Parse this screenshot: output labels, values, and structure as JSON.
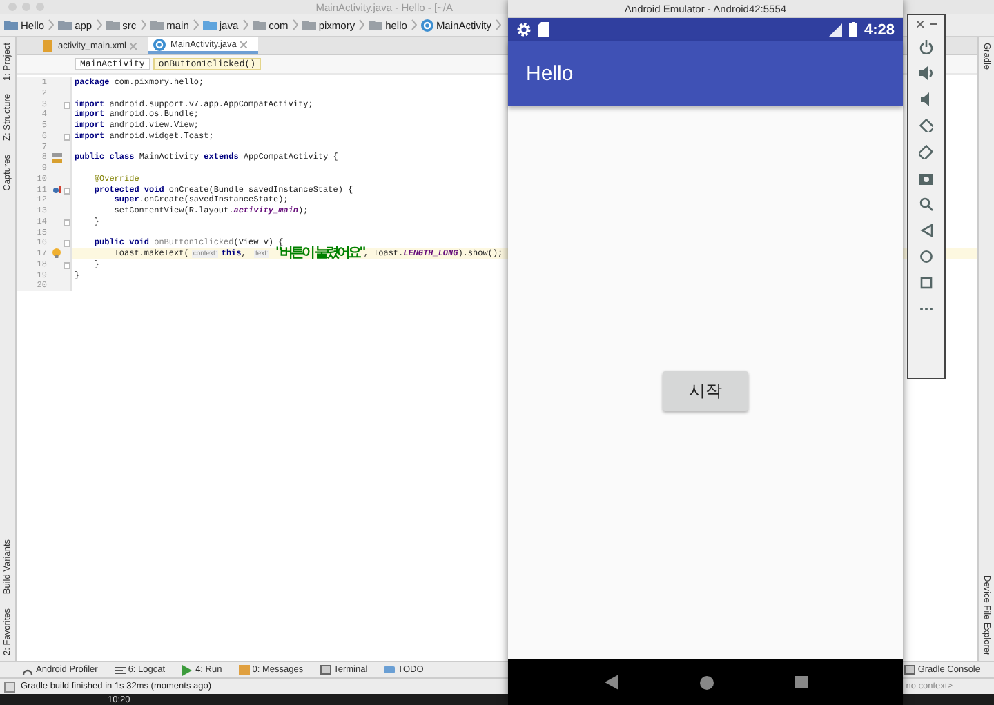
{
  "ide": {
    "title": "MainActivity.java - Hello - [~/A",
    "breadcrumbs": [
      {
        "label": "Hello",
        "kind": "project"
      },
      {
        "label": "app",
        "kind": "module"
      },
      {
        "label": "src",
        "kind": "folder"
      },
      {
        "label": "main",
        "kind": "folder"
      },
      {
        "label": "java",
        "kind": "source"
      },
      {
        "label": "com",
        "kind": "package"
      },
      {
        "label": "pixmory",
        "kind": "package"
      },
      {
        "label": "hello",
        "kind": "package"
      },
      {
        "label": "MainActivity",
        "kind": "class"
      }
    ],
    "tabs": [
      {
        "label": "activity_main.xml",
        "kind": "xml",
        "selected": false
      },
      {
        "label": "MainActivity.java",
        "kind": "class",
        "selected": true
      }
    ],
    "editor_breadcrumbs": [
      {
        "label": "MainActivity",
        "selected": false
      },
      {
        "label": "onButton1clicked()",
        "selected": true
      }
    ],
    "code_lines": [
      {
        "number": "1",
        "current": false,
        "kind": "plain",
        "fold": false,
        "segments": [
          {
            "kind": "kw",
            "text": "package"
          },
          {
            "kind": "plain",
            "text": " com.pixmory.hello;"
          }
        ]
      },
      {
        "number": "2",
        "current": false,
        "kind": "plain",
        "fold": false
      },
      {
        "number": "3",
        "current": false,
        "kind": "plain",
        "fold": true,
        "segments": [
          {
            "kind": "kw",
            "text": "import"
          },
          {
            "kind": "plain",
            "text": " android.support.v7.app.AppCompatActivity;"
          }
        ]
      },
      {
        "number": "4",
        "current": false,
        "kind": "plain",
        "fold": false,
        "segments": [
          {
            "kind": "kw",
            "text": "import"
          },
          {
            "kind": "plain",
            "text": " android.os.Bundle;"
          }
        ]
      },
      {
        "number": "5",
        "current": false,
        "kind": "plain",
        "fold": false,
        "segments": [
          {
            "kind": "kw",
            "text": "import"
          },
          {
            "kind": "plain",
            "text": " android.view.View;"
          }
        ]
      },
      {
        "number": "6",
        "current": false,
        "kind": "plain",
        "fold": true,
        "segments": [
          {
            "kind": "kw",
            "text": "import"
          },
          {
            "kind": "plain",
            "text": " android.widget.Toast;"
          }
        ]
      },
      {
        "number": "7",
        "current": false,
        "kind": "plain",
        "fold": false
      },
      {
        "number": "8",
        "current": false,
        "kind": "class",
        "fold": false,
        "segments": [
          {
            "kind": "kw",
            "text": "public class"
          },
          {
            "kind": "plain",
            "text": " MainActivity "
          },
          {
            "kind": "kw",
            "text": "extends"
          },
          {
            "kind": "plain",
            "text": " AppCompatActivity {"
          }
        ]
      },
      {
        "number": "9",
        "current": false,
        "kind": "plain",
        "fold": false
      },
      {
        "number": "10",
        "current": false,
        "kind": "plain",
        "fold": false,
        "segments": [
          {
            "kind": "ann",
            "text": "    @Override"
          }
        ]
      },
      {
        "number": "11",
        "current": false,
        "kind": "override",
        "fold": true,
        "segments": [
          {
            "kind": "kw",
            "text": "    protected void"
          },
          {
            "kind": "plain",
            "text": " onCreate(Bundle savedInstanceState) {"
          }
        ]
      },
      {
        "number": "12",
        "current": false,
        "kind": "plain",
        "fold": false,
        "segments": [
          {
            "kind": "kw",
            "text": "        super"
          },
          {
            "kind": "plain",
            "text": ".onCreate(savedInstanceState);"
          }
        ]
      },
      {
        "number": "13",
        "current": false,
        "kind": "plain",
        "fold": false,
        "segments": [
          {
            "kind": "plain",
            "text": "        setContentView(R.layout."
          },
          {
            "kind": "field",
            "text": "activity_main"
          },
          {
            "kind": "plain",
            "text": ");"
          }
        ]
      },
      {
        "number": "14",
        "current": false,
        "kind": "plain",
        "fold": true,
        "segments": [
          {
            "kind": "plain",
            "text": "    }"
          }
        ]
      },
      {
        "number": "15",
        "current": false,
        "kind": "plain",
        "fold": false
      },
      {
        "number": "16",
        "current": false,
        "kind": "plain",
        "fold": true,
        "segments": [
          {
            "kind": "kw",
            "text": "    public void "
          },
          {
            "kind": "unused",
            "text": "onButton1clicked"
          },
          {
            "kind": "plain",
            "text": "(View v) {"
          }
        ]
      },
      {
        "number": "17",
        "current": true,
        "kind": "bulb",
        "fold": false,
        "segments": [
          {
            "kind": "plain",
            "text": "        Toast.makeText("
          },
          {
            "kind": "hint",
            "text": "context:"
          },
          {
            "kind": "kw",
            "text": "this"
          },
          {
            "kind": "plain",
            "text": ", "
          },
          {
            "kind": "hint",
            "text": "text:"
          },
          {
            "kind": "str",
            "text": "\"버튼이 눌렸어요\""
          },
          {
            "kind": "plain",
            "text": ", Toast."
          },
          {
            "kind": "field",
            "text": "LENGTH_LONG"
          },
          {
            "kind": "plain",
            "text": ").show();"
          }
        ]
      },
      {
        "number": "18",
        "current": false,
        "kind": "plain",
        "fold": true,
        "segments": [
          {
            "kind": "plain",
            "text": "    }"
          }
        ]
      },
      {
        "number": "19",
        "current": false,
        "kind": "plain",
        "fold": false,
        "segments": [
          {
            "kind": "plain",
            "text": "}"
          }
        ]
      },
      {
        "number": "20",
        "current": false,
        "kind": "plain",
        "fold": false
      }
    ],
    "left_tools_top": [
      "1: Project",
      "Z: Structure",
      "Captures"
    ],
    "left_tools_bottom": [
      "Build Variants",
      "2: Favorites"
    ],
    "right_tools_top": [
      "Gradle"
    ],
    "right_tools_bottom": [
      "Device File Explorer"
    ],
    "bottom_tools": [
      {
        "label": "Android Profiler",
        "kind": "profiler"
      },
      {
        "label": "6: Logcat",
        "kind": "logcat"
      },
      {
        "label": "4: Run",
        "kind": "run"
      },
      {
        "label": "0: Messages",
        "kind": "messages"
      },
      {
        "label": "Terminal",
        "kind": "terminal"
      },
      {
        "label": "TODO",
        "kind": "todo"
      }
    ],
    "bottom_tools_right": [
      {
        "label": "Gradle Console",
        "kind": "terminal"
      }
    ],
    "status": {
      "message": "Gradle build finished in 1s 32ms (moments ago)",
      "context": "no context>"
    },
    "dock_clock": "10:20"
  },
  "emulator": {
    "title": "Android Emulator - Android42:5554",
    "time": "4:28",
    "app_title": "Hello",
    "button": "시작"
  }
}
